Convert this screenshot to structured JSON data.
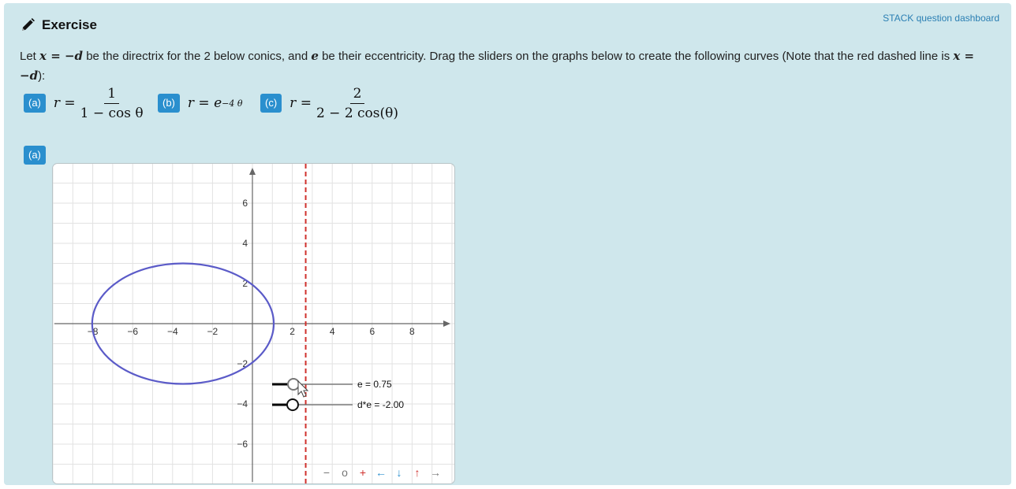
{
  "header": {
    "title": "Exercise",
    "dashboard_link": "STACK question dashboard"
  },
  "question": {
    "intro_1": "Let ",
    "math_directrix": "x = −d",
    "intro_2": " be the directrix for the 2 below conics, and ",
    "math_e": "e",
    "intro_3": " be their eccentricity. Drag the sliders on the graphs below to create the following curves (Note that the red dashed line is ",
    "math_directrix_2": "x = −d",
    "intro_4": "):"
  },
  "parts": [
    {
      "badge": "(a)",
      "lhs": "r =",
      "numerator": "1",
      "denominator": "1 − cos θ"
    },
    {
      "badge": "(b)",
      "lhs": "r = e",
      "exponent": "−4 θ"
    },
    {
      "badge": "(c)",
      "lhs": "r =",
      "numerator": "2",
      "denominator": "2 − 2 cos(θ)"
    }
  ],
  "graph_section": {
    "badge": "(a)"
  },
  "graph": {
    "x_ticks": [
      "−8",
      "−6",
      "−4",
      "−2",
      "2",
      "4",
      "6",
      "8"
    ],
    "y_ticks": [
      "6",
      "4",
      "2",
      "−2",
      "−4",
      "−6"
    ],
    "slider_e_label": "e = 0.75",
    "slider_de_label": "d*e = -2.00",
    "nav": [
      "−",
      "o",
      "+",
      "←",
      "↓",
      "↑",
      "→"
    ],
    "colors": {
      "curve": "#5b5bc8",
      "directrix": "#d0312d",
      "grid": "#e2e2e2",
      "axis": "#666666"
    },
    "e_value": 0.75,
    "de_value": -2.0,
    "directrix_x": 2.67
  }
}
